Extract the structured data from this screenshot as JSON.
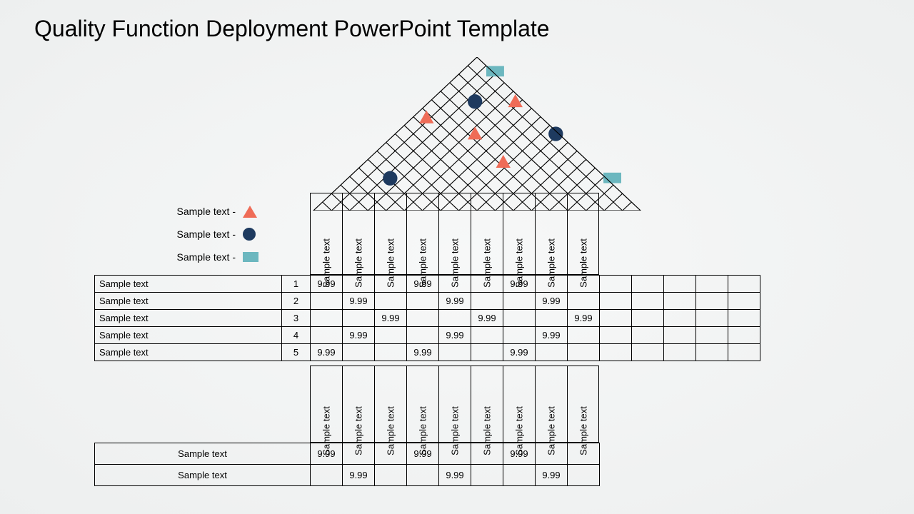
{
  "title": "Quality Function Deployment PowerPoint Template",
  "legend": [
    {
      "label": "Sample text -",
      "shape": "triangle"
    },
    {
      "label": "Sample text -",
      "shape": "circle"
    },
    {
      "label": "Sample text -",
      "shape": "rect"
    }
  ],
  "column_headers": [
    "Sample text",
    "Sample text",
    "Sample text",
    "Sample text",
    "Sample text",
    "Sample text",
    "Sample text",
    "Sample text",
    "Sample text"
  ],
  "rows": [
    {
      "label": "Sample text",
      "idx": "1",
      "cells": [
        "9.99",
        "",
        "",
        "9.99",
        "",
        "",
        "9.99",
        "",
        ""
      ]
    },
    {
      "label": "Sample text",
      "idx": "2",
      "cells": [
        "",
        "9.99",
        "",
        "",
        "9.99",
        "",
        "",
        "9.99",
        ""
      ]
    },
    {
      "label": "Sample text",
      "idx": "3",
      "cells": [
        "",
        "",
        "9.99",
        "",
        "",
        "9.99",
        "",
        "",
        "9.99"
      ]
    },
    {
      "label": "Sample text",
      "idx": "4",
      "cells": [
        "",
        "9.99",
        "",
        "",
        "9.99",
        "",
        "",
        "9.99",
        ""
      ]
    },
    {
      "label": "Sample text",
      "idx": "5",
      "cells": [
        "9.99",
        "",
        "",
        "9.99",
        "",
        "",
        "9.99",
        "",
        ""
      ]
    }
  ],
  "right_extra_cols": 5,
  "column_headers2": [
    "Sample text",
    "Sample text",
    "Sample text",
    "Sample text",
    "Sample text",
    "Sample text",
    "Sample text",
    "Sample text",
    "Sample text"
  ],
  "bottom_rows": [
    {
      "label": "Sample text",
      "cells": [
        "9.99",
        "",
        "",
        "9.99",
        "",
        "",
        "9.99",
        "",
        ""
      ]
    },
    {
      "label": "Sample text",
      "cells": [
        "",
        "9.99",
        "",
        "",
        "9.99",
        "",
        "",
        "9.99",
        ""
      ]
    }
  ],
  "roof_markers": [
    {
      "shape": "rect",
      "gx": 225,
      "gy": 18
    },
    {
      "shape": "circle",
      "gx": 200,
      "gy": 55
    },
    {
      "shape": "triangle",
      "gx": 250,
      "gy": 55
    },
    {
      "shape": "triangle",
      "gx": 140,
      "gy": 75
    },
    {
      "shape": "triangle",
      "gx": 200,
      "gy": 95
    },
    {
      "shape": "circle",
      "gx": 300,
      "gy": 95
    },
    {
      "shape": "triangle",
      "gx": 235,
      "gy": 130
    },
    {
      "shape": "circle",
      "gx": 95,
      "gy": 150
    },
    {
      "shape": "rect",
      "gx": 370,
      "gy": 150
    }
  ]
}
